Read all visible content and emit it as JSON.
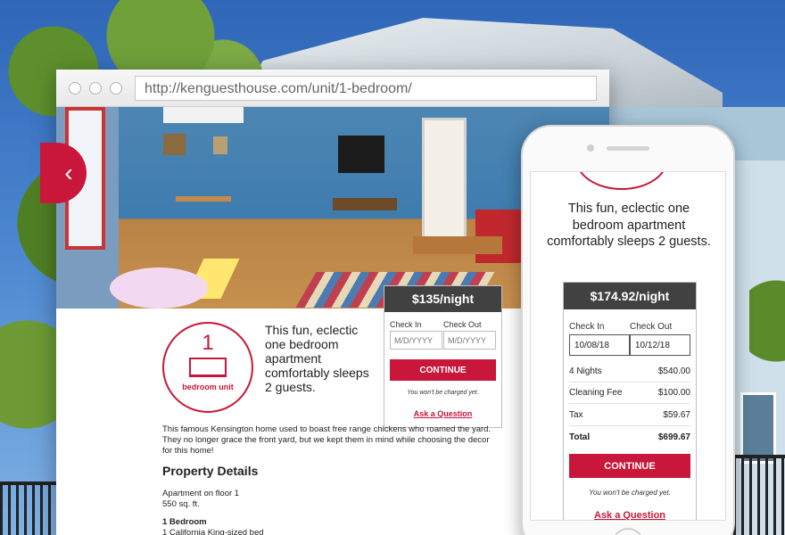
{
  "browser": {
    "url": "http://kenguesthouse.com/unit/1-bedroom/"
  },
  "listing": {
    "unit_number": "1",
    "unit_label": "bedroom unit",
    "intro": "This fun, eclectic one bedroom apartment comfortably sleeps 2 guests.",
    "description": "This famous Kensington home used to boast free range chickens who roamed the yard. They no longer grace the front yard, but we kept them in mind while choosing the decor for this home!",
    "details_title": "Property Details",
    "details": [
      "Apartment on floor 1",
      "550 sq. ft."
    ],
    "bedroom_heading": "1 Bedroom",
    "bedroom_detail": "1 California King-sized bed"
  },
  "booking_desktop": {
    "price": "$135/night",
    "check_in_label": "Check In",
    "check_out_label": "Check Out",
    "check_in_placeholder": "M/D/YYYY",
    "check_out_placeholder": "M/D/YYYY",
    "cta": "CONTINUE",
    "note": "You won't be charged yet.",
    "ask": "Ask a Question"
  },
  "booking_mobile": {
    "price": "$174.92/night",
    "check_in_label": "Check In",
    "check_out_label": "Check Out",
    "check_in_value": "10/08/18",
    "check_out_value": "10/12/18",
    "lines": [
      {
        "label": "4 Nights",
        "amount": "$540.00"
      },
      {
        "label": "Cleaning Fee",
        "amount": "$100.00"
      },
      {
        "label": "Tax",
        "amount": "$59.67"
      },
      {
        "label": "Total",
        "amount": "$699.67"
      }
    ],
    "cta": "CONTINUE",
    "note": "You won't be charged yet.",
    "ask": "Ask a Question"
  },
  "colors": {
    "brand": "#c8173a",
    "price_header": "#414141"
  },
  "icons": [
    "chevron-left-icon",
    "bed-icon"
  ]
}
